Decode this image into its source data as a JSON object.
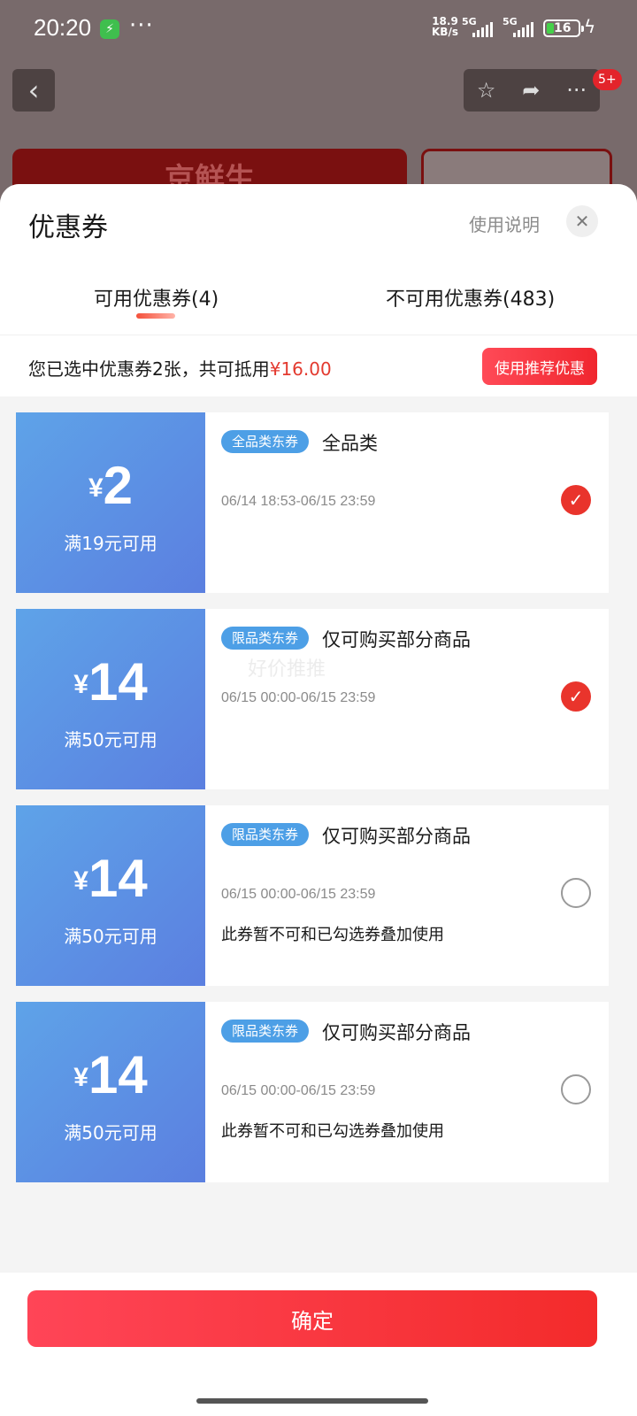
{
  "status_bar": {
    "time": "20:20",
    "dots": "···",
    "net_speed_value": "18.9",
    "net_speed_unit": "KB/s",
    "signal_1": "5G",
    "signal_2": "5G",
    "battery": "16"
  },
  "background_page": {
    "top_badge": "5+",
    "banner_text": "京鲜生"
  },
  "sheet": {
    "title": "优惠券",
    "help_link": "使用说明",
    "tabs": [
      {
        "label": "可用优惠券(4)",
        "active": true
      },
      {
        "label": "不可用优惠券(483)",
        "active": false
      }
    ],
    "summary_prefix": "您已选中优惠券2张，共可抵用",
    "summary_amount": "¥16.00",
    "recommend_button": "使用推荐优惠",
    "watermark": "好价推推",
    "coupons": [
      {
        "currency": "¥",
        "amount": "2",
        "condition": "满19元可用",
        "tag": "全品类东券",
        "title": "全品类",
        "period": "06/14 18:53-06/15 23:59",
        "note": "",
        "selected": true
      },
      {
        "currency": "¥",
        "amount": "14",
        "condition": "满50元可用",
        "tag": "限品类东券",
        "title": "仅可购买部分商品",
        "period": "06/15 00:00-06/15 23:59",
        "note": "",
        "selected": true
      },
      {
        "currency": "¥",
        "amount": "14",
        "condition": "满50元可用",
        "tag": "限品类东券",
        "title": "仅可购买部分商品",
        "period": "06/15 00:00-06/15 23:59",
        "note": "此券暂不可和已勾选券叠加使用",
        "selected": false
      },
      {
        "currency": "¥",
        "amount": "14",
        "condition": "满50元可用",
        "tag": "限品类东券",
        "title": "仅可购买部分商品",
        "period": "06/15 00:00-06/15 23:59",
        "note": "此券暂不可和已勾选券叠加使用",
        "selected": false
      }
    ],
    "confirm_button": "确定"
  },
  "colors": {
    "accent_red": "#e9342c",
    "coupon_blue": "#5b8ee5",
    "tag_blue": "#4d9fe6"
  }
}
